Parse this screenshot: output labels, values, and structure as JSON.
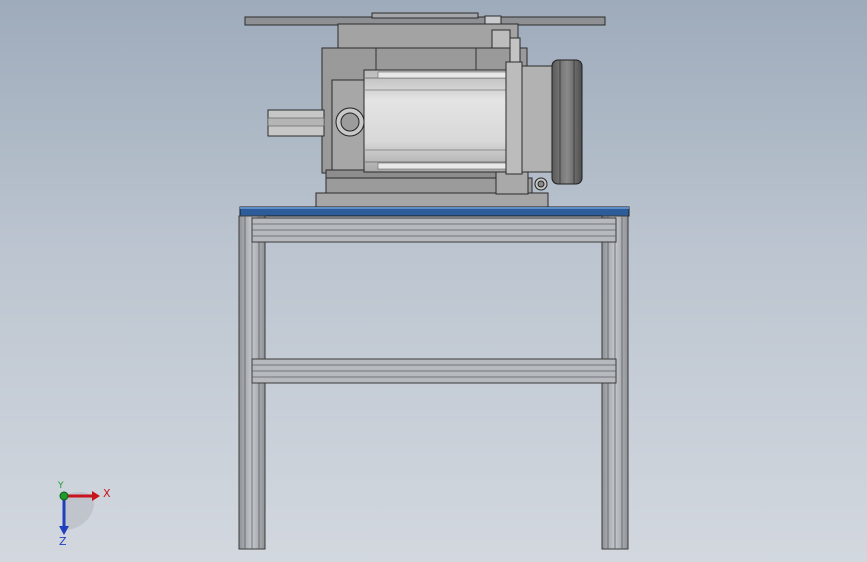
{
  "triad": {
    "x_label": "X",
    "y_label": "Y",
    "z_label": "Z",
    "x_color": "#c8141e",
    "y_color": "#1f9a2c",
    "z_color": "#1f3fbf"
  },
  "model": {
    "frame_color": "#a9adb2",
    "top_plate_color": "#2c5c9a",
    "housing_color": "#9c9c9c",
    "motor_color": "#d2d2d2"
  }
}
